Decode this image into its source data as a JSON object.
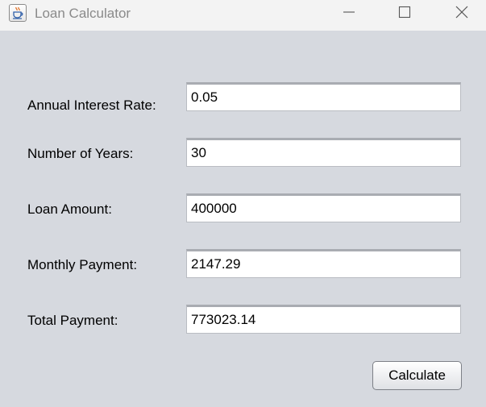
{
  "window": {
    "title": "Loan Calculator",
    "icon": "java-coffee-cup-icon",
    "controls": [
      "minimize-icon",
      "maximize-icon",
      "close-icon"
    ]
  },
  "form": {
    "annual_interest_rate": {
      "label": "Annual Interest Rate:",
      "value": "0.05"
    },
    "number_of_years": {
      "label": "Number of Years:",
      "value": "30"
    },
    "loan_amount": {
      "label": "Loan Amount:",
      "value": "400000"
    },
    "monthly_payment": {
      "label": "Monthly Payment:",
      "value": "2147.29"
    },
    "total_payment": {
      "label": "Total Payment:",
      "value": "773023.14"
    }
  },
  "actions": {
    "calculate_label": "Calculate"
  },
  "colors": {
    "window_background": "#d6d9df",
    "titlebar_background": "#f3f3f3",
    "title_text": "#8a8a8a",
    "field_background": "#ffffff",
    "text": "#000000"
  }
}
